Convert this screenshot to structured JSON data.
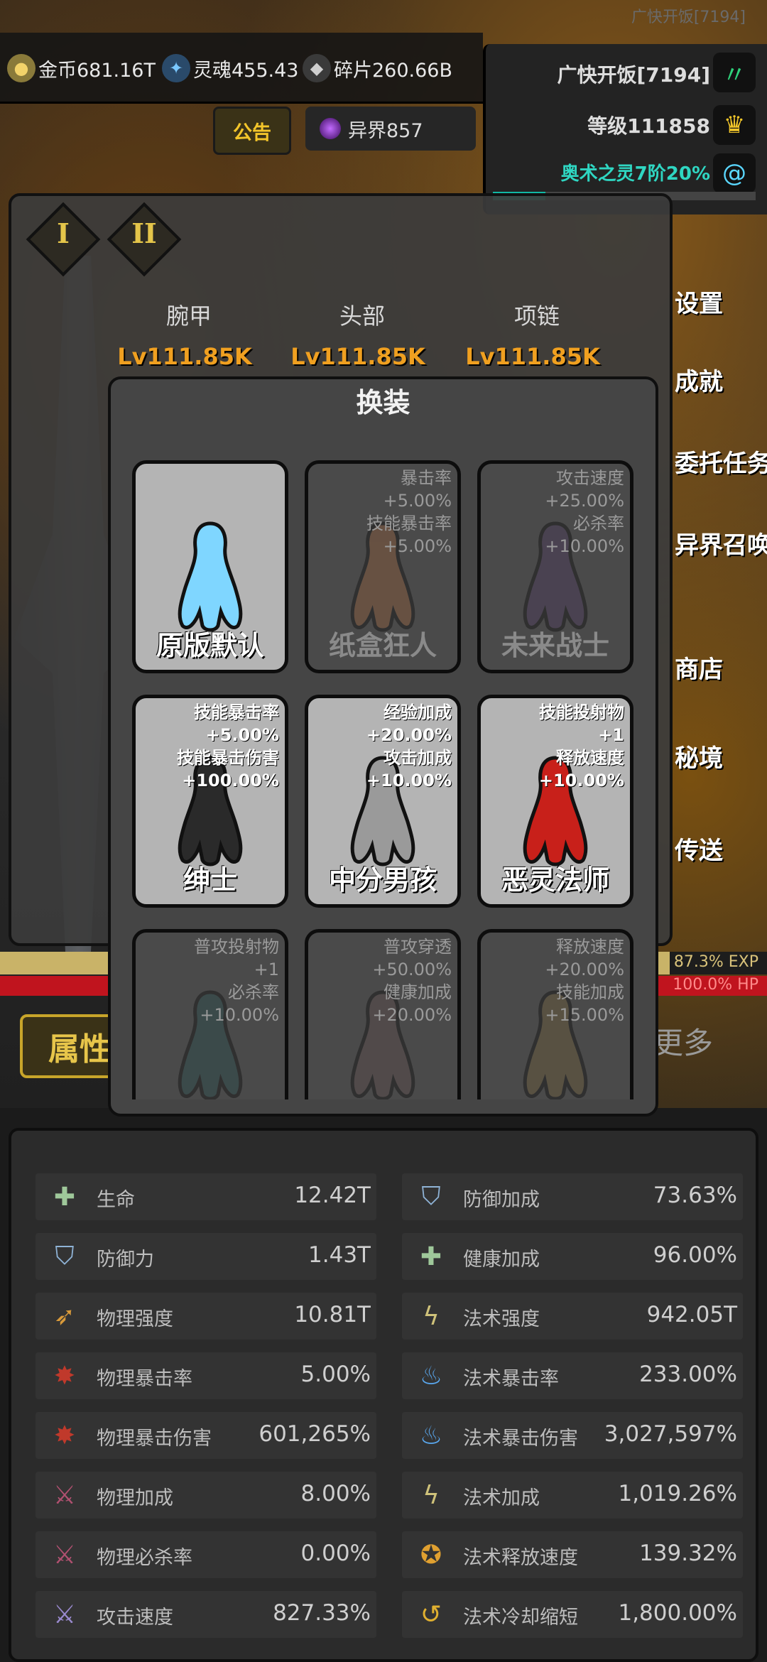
{
  "header": {
    "ghost_title": "广快开饭[7194]",
    "resources": [
      {
        "icon": "gold-coin-icon",
        "label": "金币681.16T"
      },
      {
        "icon": "soul-icon",
        "label": "灵魂455.43"
      },
      {
        "icon": "fragment-icon",
        "label": "碎片260.66B"
      }
    ],
    "notice_label": "公告",
    "otherworld_label": "异界857"
  },
  "player": {
    "name": "广快开饭[7194]",
    "level": "等级111858",
    "arcane": "奥术之灵7阶20%",
    "arcane_progress": 0.2
  },
  "side_menu": [
    "设置",
    "成就",
    "委托任务",
    "异界召唤",
    "商店",
    "秘境",
    "传送"
  ],
  "equipment": {
    "ranks": [
      "I",
      "II"
    ],
    "slots": [
      {
        "name": "腕甲",
        "level": "Lv111.85K"
      },
      {
        "name": "头部",
        "level": "Lv111.85K"
      },
      {
        "name": "项链",
        "level": "Lv111.85K"
      }
    ]
  },
  "bars": {
    "exp_text": "87.3% EXP",
    "exp_fraction": 0.873,
    "hp_text": "100.0% HP",
    "hp_fraction": 1.0
  },
  "tabs": {
    "attributes": "属性",
    "more": "更多"
  },
  "modal": {
    "title": "换装",
    "skins": [
      {
        "name": "原版默认",
        "stats": [],
        "unlocked": true,
        "color": "#7fd6ff"
      },
      {
        "name": "纸盒狂人",
        "stats": [
          "暴击率",
          "+5.00%",
          "技能暴击率",
          "+5.00%"
        ],
        "unlocked": false,
        "color": "#8a5a3a"
      },
      {
        "name": "未来战士",
        "stats": [
          "攻击速度",
          "+25.00%",
          "必杀率",
          "+10.00%"
        ],
        "unlocked": false,
        "color": "#4a3a5a"
      },
      {
        "name": "绅士",
        "stats": [
          "技能暴击率",
          "+5.00%",
          "技能暴击伤害",
          "+100.00%"
        ],
        "unlocked": true,
        "color": "#2a2a2a"
      },
      {
        "name": "中分男孩",
        "stats": [
          "经验加成",
          "+20.00%",
          "攻击加成",
          "+10.00%"
        ],
        "unlocked": true,
        "color": "#9a9a9a"
      },
      {
        "name": "恶灵法师",
        "stats": [
          "技能投射物",
          "+1",
          "释放速度",
          "+10.00%"
        ],
        "unlocked": true,
        "color": "#c8201a"
      },
      {
        "name": "",
        "stats": [
          "普攻投射物",
          "+1",
          "必杀率",
          "+10.00%"
        ],
        "unlocked": false,
        "color": "#2a4a4a"
      },
      {
        "name": "",
        "stats": [
          "普攻穿透",
          "+50.00%",
          "健康加成",
          "+20.00%"
        ],
        "unlocked": false,
        "color": "#5a4a4a"
      },
      {
        "name": "",
        "stats": [
          "释放速度",
          "+20.00%",
          "技能加成",
          "+15.00%"
        ],
        "unlocked": false,
        "color": "#6a5a3a"
      }
    ]
  },
  "stats": {
    "left": [
      {
        "icon": "health-cross-icon",
        "label": "生命",
        "value": "12.42T"
      },
      {
        "icon": "shield-icon",
        "label": "防御力",
        "value": "1.43T"
      },
      {
        "icon": "physical-power-icon",
        "label": "物理强度",
        "value": "10.81T"
      },
      {
        "icon": "physical-crit-icon",
        "label": "物理暴击率",
        "value": "5.00%"
      },
      {
        "icon": "physical-crit-damage-icon",
        "label": "物理暴击伤害",
        "value": "601,265%"
      },
      {
        "icon": "physical-bonus-icon",
        "label": "物理加成",
        "value": "8.00%"
      },
      {
        "icon": "physical-kill-icon",
        "label": "物理必杀率",
        "value": "0.00%"
      },
      {
        "icon": "attack-speed-icon",
        "label": "攻击速度",
        "value": "827.33%"
      }
    ],
    "right": [
      {
        "icon": "defense-bonus-icon",
        "label": "防御加成",
        "value": "73.63%"
      },
      {
        "icon": "health-bonus-icon",
        "label": "健康加成",
        "value": "96.00%"
      },
      {
        "icon": "magic-power-icon",
        "label": "法术强度",
        "value": "942.05T"
      },
      {
        "icon": "magic-crit-icon",
        "label": "法术暴击率",
        "value": "233.00%"
      },
      {
        "icon": "magic-crit-damage-icon",
        "label": "法术暴击伤害",
        "value": "3,027,597%"
      },
      {
        "icon": "magic-bonus-icon",
        "label": "法术加成",
        "value": "1,019.26%"
      },
      {
        "icon": "cast-speed-icon",
        "label": "法术释放速度",
        "value": "139.32%"
      },
      {
        "icon": "cooldown-icon",
        "label": "法术冷却缩短",
        "value": "1,800.00%"
      }
    ]
  }
}
